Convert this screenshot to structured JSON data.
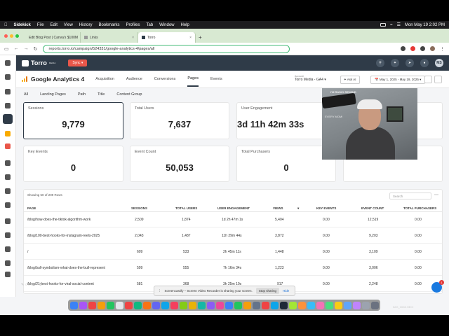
{
  "menubar": {
    "app": "Sidekick",
    "items": [
      "File",
      "Edit",
      "View",
      "History",
      "Bookmarks",
      "Profiles",
      "Tab",
      "Window",
      "Help"
    ],
    "clock": "Mon May 19  2:02 PM"
  },
  "browser": {
    "tabs": [
      {
        "label": "Edit Blog Post | Canva's $100M",
        "active": false
      },
      {
        "label": "Links",
        "active": false
      },
      {
        "label": "Torro",
        "active": true
      }
    ],
    "url": "reports.torro.io/campaign/524331/google-analytics-4/pages/all"
  },
  "app": {
    "logo": "Torro",
    "logo_sub": "MEDIA",
    "sync_label": "Sync",
    "avatar_initials": "MS",
    "ga_title": "Google Analytics 4",
    "nav_tabs": [
      "Acquisition",
      "Audience",
      "Conversions",
      "Pages",
      "Events"
    ],
    "active_tab": "Pages",
    "account_label": "Account",
    "account_value": "Torro Media - GA4",
    "ask_ai": "Ask AI",
    "date_range": "May 1, 2025 - May 19, 2025",
    "sub_tabs": [
      "All",
      "Landing Pages",
      "Path",
      "Title",
      "Content Group"
    ]
  },
  "metrics": [
    {
      "label": "Sessions",
      "value": "9,779"
    },
    {
      "label": "Total Users",
      "value": "7,637"
    },
    {
      "label": "User Engagement",
      "value": "3d 11h 42m 33s"
    },
    {
      "label": "Key Events",
      "value": "0"
    },
    {
      "label": "Event Count",
      "value": "50,053"
    },
    {
      "label": "Total Purchasers",
      "value": "0"
    }
  ],
  "table": {
    "info": "Showing 50 of 209 Rows",
    "search_placeholder": "Search",
    "columns": [
      "PAGE",
      "SESSIONS",
      "TOTAL USERS",
      "USER ENGAGEMENT",
      "VIEWS",
      "KEY EVENTS",
      "EVENT COUNT",
      "TOTAL PURCHASERS"
    ],
    "rows": [
      [
        "/blog/how-does-the-tiktok-algorithm-work",
        "2,509",
        "1,874",
        "1d 2h 47m 1s",
        "5,404",
        "0.00",
        "12,519",
        "0.00"
      ],
      [
        "/blog/100-best-hooks-for-instagram-reels-2025",
        "2,043",
        "1,487",
        "11h 29m 44s",
        "3,872",
        "0.00",
        "9,203",
        "0.00"
      ],
      [
        "/",
        "609",
        "533",
        "2h 45m 11s",
        "1,448",
        "0.00",
        "3,109",
        "0.00"
      ],
      [
        "/blog/bull-symbolism-what-does-the-bull-represent",
        "599",
        "555",
        "7h 16m 34s",
        "1,223",
        "0.00",
        "3,006",
        "0.00"
      ],
      [
        "/blog/21-best-hooks-for-viral-social-content",
        "581",
        "368",
        "3h 25m 10s",
        "917",
        "0.00",
        "2,248",
        "0.00"
      ]
    ]
  },
  "webcam": {
    "caption_top": "I'M RADIO REWIND",
    "caption_side": "EVERY MOM!"
  },
  "share_banner": {
    "text": "Screencastify – Screen Video Recorder is sharing your screen.",
    "stop": "Stop sharing",
    "hide": "Hide"
  },
  "chat_badge": "1",
  "dock_caption": "IMG_0098.HEIC"
}
